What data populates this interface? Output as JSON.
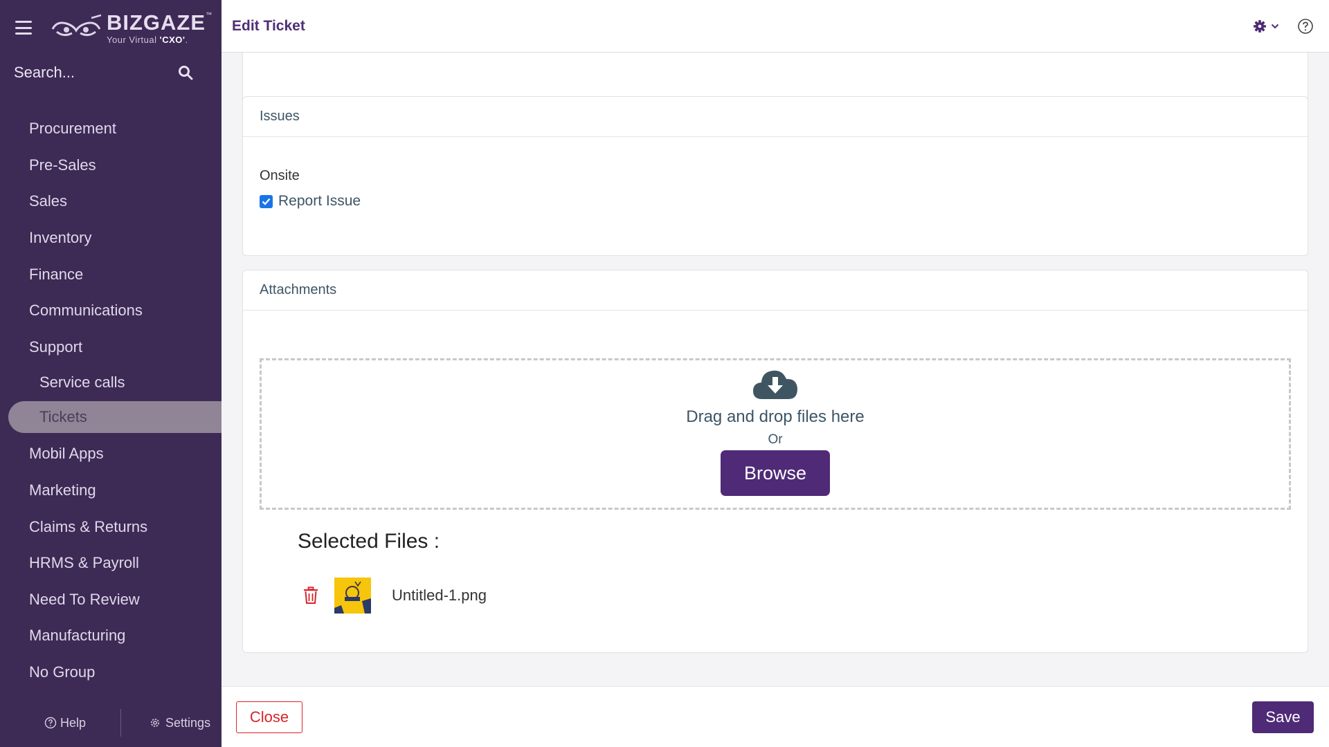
{
  "brand": {
    "name": "BIZGAZE",
    "trademark": "™",
    "tagline_prefix": "Your Virtual ",
    "tagline_bold": "'CXO'",
    "tagline_suffix": "."
  },
  "sidebar": {
    "search_placeholder": "Search...",
    "items": [
      {
        "label": "Procurement"
      },
      {
        "label": "Pre-Sales"
      },
      {
        "label": "Sales"
      },
      {
        "label": "Inventory"
      },
      {
        "label": "Finance"
      },
      {
        "label": "Communications"
      },
      {
        "label": "Support"
      }
    ],
    "support_subitems": [
      {
        "label": "Service calls"
      },
      {
        "label": "Tickets"
      }
    ],
    "items_after": [
      {
        "label": "Mobil Apps"
      },
      {
        "label": "Marketing"
      },
      {
        "label": "Claims & Returns"
      },
      {
        "label": "HRMS & Payroll"
      },
      {
        "label": "Need To Review"
      },
      {
        "label": "Manufacturing"
      },
      {
        "label": "No Group"
      }
    ],
    "help_label": "Help",
    "settings_label": "Settings"
  },
  "header": {
    "title": "Edit Ticket"
  },
  "issues": {
    "title": "Issues",
    "onsite_label": "Onsite",
    "report_issue_label": "Report Issue",
    "report_issue_checked": true
  },
  "attachments": {
    "title": "Attachments",
    "drop_text": "Drag and drop files here",
    "or_text": "Or",
    "browse_label": "Browse",
    "selected_title": "Selected Files :",
    "files": [
      {
        "name": "Untitled-1.png"
      }
    ]
  },
  "footer": {
    "close_label": "Close",
    "save_label": "Save"
  },
  "colors": {
    "sidebar_bg": "#3d2a55",
    "accent": "#4f2a76",
    "danger": "#d9242a",
    "checkbox": "#1a73e8"
  }
}
